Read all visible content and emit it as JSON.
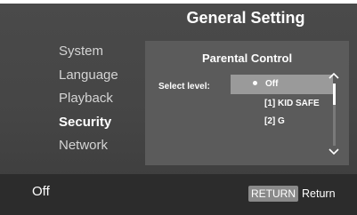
{
  "header": {
    "title": "General Setting"
  },
  "sidebar": {
    "items": [
      {
        "label": "System"
      },
      {
        "label": "Language"
      },
      {
        "label": "Playback"
      },
      {
        "label": "Security"
      },
      {
        "label": "Network"
      }
    ],
    "active_index": 3
  },
  "panel": {
    "title": "Parental Control",
    "select_label": "Select level:",
    "options": [
      {
        "label": "Off",
        "selected": true
      },
      {
        "label": "[1] KID SAFE",
        "selected": false
      },
      {
        "label": "[2] G",
        "selected": false
      }
    ],
    "scroll_icons": {
      "up": "chevron-up-icon",
      "down": "chevron-down-icon"
    }
  },
  "footer": {
    "status": "Off",
    "return_key": "RETURN",
    "return_label": "Return"
  },
  "colors": {
    "background": "#454545",
    "panel": "#5b5b5b",
    "selected_option": "#9a9a9a",
    "footer": "#2c2c2c",
    "text": "#ffffff"
  }
}
